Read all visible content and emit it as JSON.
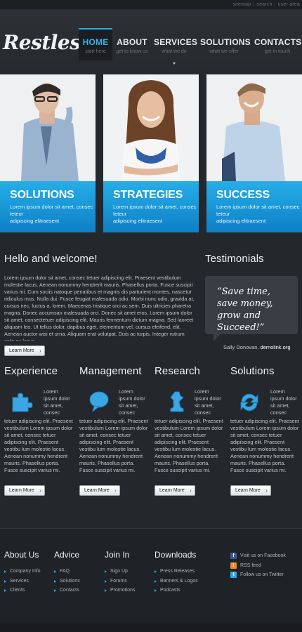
{
  "top_links": [
    "sitemap",
    "search",
    "user area"
  ],
  "logo": "Restless",
  "nav": [
    {
      "label": "HOME",
      "sub": "start here",
      "active": true
    },
    {
      "label": "ABOUT",
      "sub": "get to know us",
      "active": false
    },
    {
      "label": "SERVICES",
      "sub": "what we do",
      "active": false
    },
    {
      "label": "SOLUTIONS",
      "sub": "what we offer",
      "active": false
    },
    {
      "label": "CONTACTS",
      "sub": "get in touch",
      "active": false
    }
  ],
  "banners": [
    {
      "title": "SOLUTIONS",
      "text_line1": "Lorem ipsum dolor sit amet, consec teteur",
      "text_line2": "adipiscing elitraesent"
    },
    {
      "title": "STRATEGIES",
      "text_line1": "Lorem ipsum dolor sit amet, consec teteur",
      "text_line2": "adipiscing elitraesent"
    },
    {
      "title": "SUCCESS",
      "text_line1": "Lorem ipsum dolor sit amet, consec teteur",
      "text_line2": "adipiscing elitraesent"
    }
  ],
  "welcome": {
    "title": "Hello and welcome!",
    "body": "Lorem ipsum dolor sit amet, consec tetuer adipiscing elit. Praesent vestibulum molestie lacus. Aenean nonummy hendrerit mauris. Phasellus porta. Fusce suscipit varius mi. Cum sociis natoque penatibus et magnis dis parturient montes, nascetur ridiculus mus. Nulla dui. Fusce feugiat malesuada odio. Morbi nunc odio, gravida at, cursus nec, luctus a, lorem. Maecenas tristique orci ac sem. Duis ultricies pharetra magna. Donec accumsan malesuada orci. Donec sit amet eros. Lorem ipsum dolor sit amet, consectetuer adipiscing elit. Mauris fermentum dictum magna. Sed laoreet aliquam leo. Ut tellus dolor, dapibus eget, elementum vel, cursus eleifend, elit. Aenean auctor wisi et urna. Aliquam erat volutpat. Duis ac turpis. Integer rutrum ante eu lacus.",
    "button": "Learn More"
  },
  "testimonials": {
    "title": "Testimonials",
    "quote": "“Save time, save money, grow and Succeed!”",
    "author": "Sally Donovan,",
    "site": "demolink.org"
  },
  "services": [
    {
      "title": "Experience",
      "icon": "puzzle-icon",
      "short": "Lorem ipsum dolor sit amet, consec",
      "long": "tetuer adipiscing elit. Praesent vestibulum Lorem ipsum dolor sit amet, consec tetuer adipiscing elit. Praesent vestibu lum molestie lacus. Aenean nonummy hendrerit mauris. Phasellus porta. Fusce suscipit varius mi.",
      "button": "Learn More"
    },
    {
      "title": "Management",
      "icon": "speech-bubble-icon",
      "short": "Lorem ipsum dolor sit amet, consec",
      "long": "tetuer adipiscing elit. Praesent vestibulum Lorem ipsum dolor sit amet, consec tetuer adipiscing elit. Praesent vestibu lum molestie lacus. Aenean nonummy hendrerit mauris. Phasellus porta. Fusce suscipit varius mi.",
      "button": "Learn More"
    },
    {
      "title": "Research",
      "icon": "chess-piece-icon",
      "short": "Lorem ipsum dolor sit amet, consec",
      "long": "tetuer adipiscing elit. Praesent vestibulum Lorem ipsum dolor sit amet, consec tetuer adipiscing elit. Praesent vestibu lum molestie lacus. Aenean nonummy hendrerit mauris. Phasellus porta. Fusce suscipit varius mi.",
      "button": "Learn More"
    },
    {
      "title": "Solutions",
      "icon": "refresh-arrows-icon",
      "short": "Lorem ipsum dolor sit amet, consec",
      "long": "tetuer adipiscing elit. Praesent vestibulum Lorem ipsum dolor sit amet, consec tetuer adipiscing elit. Praesent vestibu lum molestie lacus. Aenean nonummy hendrerit mauris. Phasellus porta. Fusce suscipit varius mi.",
      "button": "Learn More"
    }
  ],
  "footer": {
    "about": {
      "title": "About Us",
      "items": [
        "Company Info",
        "Services",
        "Clients"
      ]
    },
    "advice": {
      "title": "Advice",
      "items": [
        "FAQ",
        "Solutions",
        "Contacts"
      ]
    },
    "join": {
      "title": "Join In",
      "items": [
        "Sign Up",
        "Forums",
        "Promotions"
      ]
    },
    "downloads": {
      "title": "Downloads",
      "items": [
        "Press Releases",
        "Banners & Logos",
        "Podcasts"
      ]
    },
    "social": [
      {
        "label": "Visit us on Facebook",
        "icon": "facebook-icon",
        "color": "#3b5998"
      },
      {
        "label": "RSS feed",
        "icon": "rss-icon",
        "color": "#f08a24"
      },
      {
        "label": "Follow us on Twitter",
        "icon": "twitter-icon",
        "color": "#2fa8e6"
      }
    ]
  },
  "colors": {
    "accent": "#2fa8e6",
    "background": "#24272c",
    "banner_blue": "#1a95d8"
  }
}
